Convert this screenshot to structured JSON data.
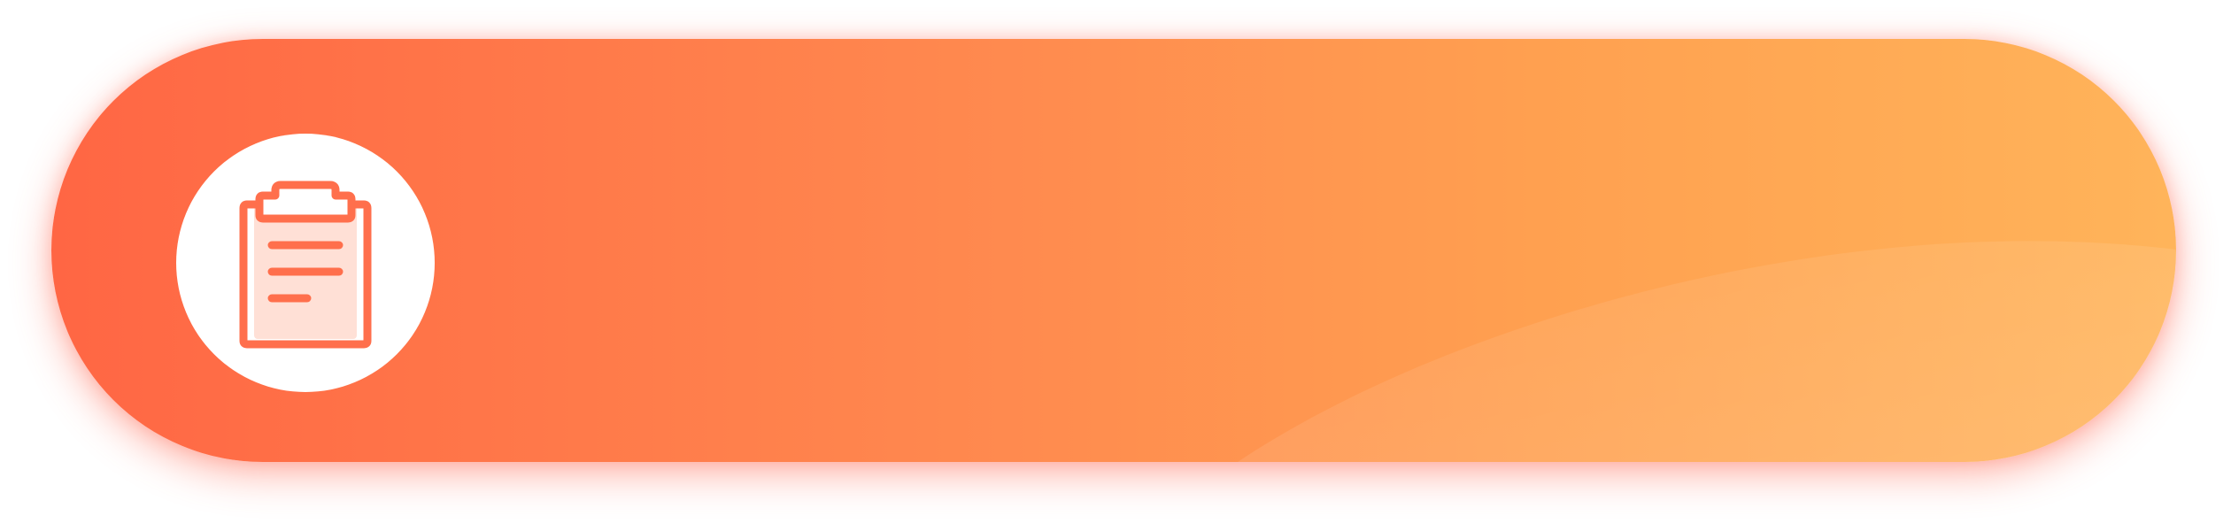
{
  "banner": {
    "gradient_start": "#ff6644",
    "gradient_end": "#ffb45a",
    "icon": "clipboard-list-icon",
    "icon_color": "#ff6f4c",
    "icon_fill": "#ffe0d6"
  }
}
